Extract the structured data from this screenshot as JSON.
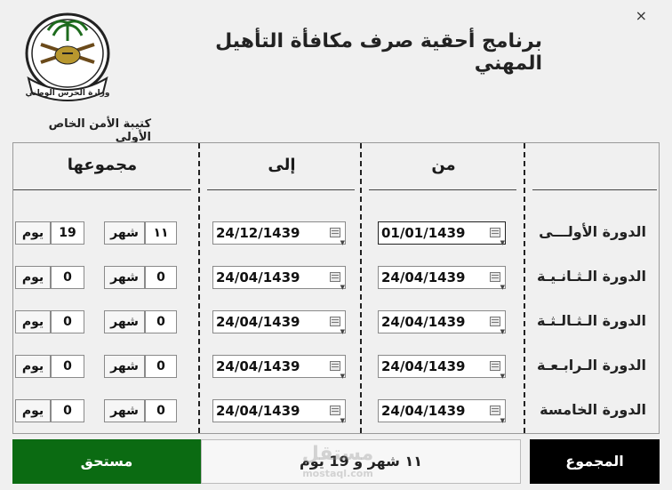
{
  "window": {
    "close_icon": "×"
  },
  "header": {
    "title": "برنامج أحقية صرف مكافأة التأهيل المهني",
    "unit": "كتيبة الأمن الخاص الأولى",
    "emblem_text": "وزارة الحرس الوطني"
  },
  "columns": {
    "from": "من",
    "to": "إلى",
    "total": "مجموعها"
  },
  "units": {
    "month": "شهر",
    "day": "يوم"
  },
  "rows": [
    {
      "label": "الدورة الأولـــى",
      "from": "01/01/1439",
      "to": "24/12/1439",
      "months": "١١",
      "days": "19"
    },
    {
      "label": "الدورة الـثـانـيـة",
      "from": "24/04/1439",
      "to": "24/04/1439",
      "months": "0",
      "days": "0"
    },
    {
      "label": "الدورة الـثـالـثـة",
      "from": "24/04/1439",
      "to": "24/04/1439",
      "months": "0",
      "days": "0"
    },
    {
      "label": "الدورة الـرابـعـة",
      "from": "24/04/1439",
      "to": "24/04/1439",
      "months": "0",
      "days": "0"
    },
    {
      "label": "الدورة الخامسة",
      "from": "24/04/1439",
      "to": "24/04/1439",
      "months": "0",
      "days": "0"
    }
  ],
  "footer": {
    "status": "مستحق",
    "result": "١١ شهر و 19 يوم",
    "total_button": "المجموع"
  },
  "watermark": {
    "text": "مستقل",
    "sub": "mostaql.com"
  },
  "colors": {
    "status_bg": "#0b6b12",
    "total_bg": "#000000"
  }
}
